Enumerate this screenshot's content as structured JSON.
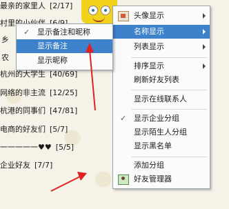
{
  "contact_groups": [
    {
      "name": "最亲的家里人",
      "count": "[2/17]"
    },
    {
      "name": "村里的小伙伴",
      "count": "[6/9]"
    },
    {
      "name": "乡",
      "count": ""
    },
    {
      "name": "农",
      "count": ""
    },
    {
      "name": "杭州的大学生",
      "count": "[40/69]"
    },
    {
      "name": "网络的非主流",
      "count": "[12/25]"
    },
    {
      "name": "杭港的同事们",
      "count": "[47/81]"
    },
    {
      "name": "电商的好友们",
      "count": "[5/7]"
    },
    {
      "name": "一一一一一♥♥",
      "count": "[5/5]"
    },
    {
      "name": "企业好友",
      "count": "[7/7]"
    }
  ],
  "main_menu": {
    "items": [
      {
        "label": "头像显示",
        "icon": "avatar-icon",
        "submenu": true
      },
      {
        "label": "名称显示",
        "submenu": true,
        "highlighted": true
      },
      {
        "label": "列表显示",
        "submenu": true
      },
      {
        "label": "排序显示",
        "submenu": true
      },
      {
        "label": "刷新好友列表"
      },
      {
        "label": "显示在线联系人"
      },
      {
        "label": "显示企业分组",
        "checked": true
      },
      {
        "label": "显示陌生人分组"
      },
      {
        "label": "显示黑名单"
      },
      {
        "label": "添加分组"
      },
      {
        "label": "好友管理器",
        "icon": "friend-manager-icon"
      }
    ]
  },
  "submenu": {
    "items": [
      {
        "label": "显示备注和昵称",
        "checked": true
      },
      {
        "label": "显示备注",
        "highlighted": true
      },
      {
        "label": "显示昵称"
      }
    ]
  },
  "check_glyph": "✓",
  "colors": {
    "highlight": "#3e82cc",
    "arrow": "#e02020"
  }
}
